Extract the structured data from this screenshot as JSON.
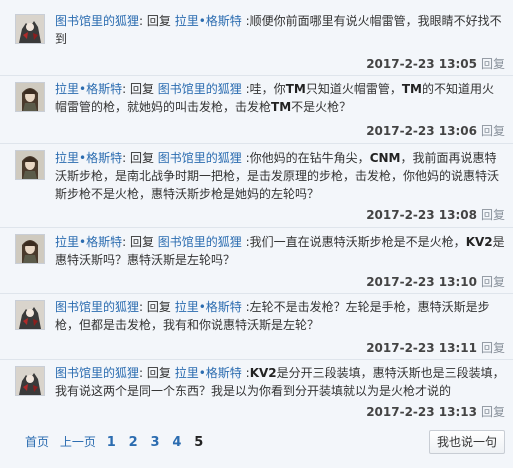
{
  "comments": [
    {
      "author": "图书馆里的狐狸",
      "reply_word": "回复",
      "target": "拉里•格斯特",
      "text_html": ":顺便你前面哪里有说火帽雷管，我眼睛不好找不到",
      "time": "2017-2-23 13:05",
      "reply_label": "回复"
    },
    {
      "author": "拉里•格斯特",
      "reply_word": "回复",
      "target": "图书馆里的狐狸",
      "text_html": ":哇，你<b>TM</b>只知道火帽雷管，<b>TM</b>的不知道用火帽雷管的枪，就她妈的叫击发枪，击发枪<b>TM</b>不是火枪？",
      "time": "2017-2-23 13:06",
      "reply_label": "回复"
    },
    {
      "author": "拉里•格斯特",
      "reply_word": "回复",
      "target": "图书馆里的狐狸",
      "text_html": ":你他妈的在钻牛角尖，<b>CNM</b>，我前面再说惠特沃斯步枪，是南北战争时期一把枪，是击发原理的步枪，击发枪，你他妈的说惠特沃斯步枪不是火枪，惠特沃斯步枪是她妈的左轮吗？",
      "time": "2017-2-23 13:08",
      "reply_label": "回复"
    },
    {
      "author": "拉里•格斯特",
      "reply_word": "回复",
      "target": "图书馆里的狐狸",
      "text_html": ":我们一直在说惠特沃斯步枪是不是火枪，<b>KV2</b>是惠特沃斯吗？惠特沃斯是左轮吗？",
      "time": "2017-2-23 13:10",
      "reply_label": "回复"
    },
    {
      "author": "图书馆里的狐狸",
      "reply_word": "回复",
      "target": "拉里•格斯特",
      "text_html": ":左轮不是击发枪？左轮是手枪，惠特沃斯是步枪，但都是击发枪，我有和你说惠特沃斯是左轮？",
      "time": "2017-2-23 13:11",
      "reply_label": "回复"
    },
    {
      "author": "图书馆里的狐狸",
      "reply_word": "回复",
      "target": "拉里•格斯特",
      "text_html": ":<b>KV2</b>是分开三段装填，惠特沃斯也是三段装填，我有说这两个是同一个东西？我是以为你看到分开装填就以为是火枪才说的",
      "time": "2017-2-23 13:13",
      "reply_label": "回复"
    }
  ],
  "pagination": {
    "first": "首页",
    "prev": "上一页",
    "pages": [
      "1",
      "2",
      "3",
      "4"
    ],
    "current": "5"
  },
  "say_button": "我也说一句",
  "colors": {
    "link": "#2b6cb0",
    "background": "#f3f6fa",
    "divider": "#dfe5ec"
  },
  "icons": {
    "fox_avatar": "avatar-fox-icon",
    "larry_avatar": "avatar-larry-icon"
  }
}
